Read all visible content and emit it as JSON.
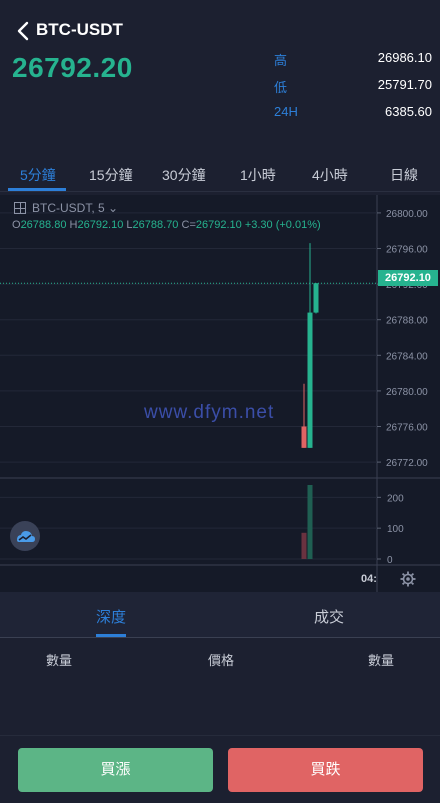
{
  "header": {
    "pair": "BTC-USDT",
    "last_price": "26792.20",
    "stats": [
      {
        "label": "高",
        "value": "26986.10"
      },
      {
        "label": "低",
        "value": "25791.70"
      },
      {
        "label": "24H",
        "value": "6385.60"
      }
    ]
  },
  "tabs": [
    {
      "label": "5分鐘",
      "active": true
    },
    {
      "label": "15分鐘"
    },
    {
      "label": "30分鐘"
    },
    {
      "label": "1小時"
    },
    {
      "label": "4小時"
    },
    {
      "label": "日線"
    }
  ],
  "chart": {
    "symbol_label": "BTC-USDT, 5",
    "ohlc": {
      "o_label": "O",
      "o": "26788.80",
      "h_label": "H",
      "h": "26792.10",
      "l_label": "L",
      "l": "26788.70",
      "c_label": "C=",
      "c": "26792.10",
      "change": "+3.30 (+0.01%)"
    },
    "current_price_tag": "26792.10",
    "watermark": "www.dfym.net",
    "time_label": "04:",
    "colors": {
      "up": "#26b38f",
      "down": "#e06464",
      "accent": "#2d7fd8"
    }
  },
  "chart_data": {
    "type": "candlestick",
    "y_ticks": [
      "26800.00",
      "26796.00",
      "26792.00",
      "26788.00",
      "26784.00",
      "26780.00",
      "26776.00",
      "26772.00"
    ],
    "ylim": [
      26771,
      26801
    ],
    "candles": [
      {
        "o": 26776.0,
        "h": 26780.8,
        "l": 26773.6,
        "c": 26773.6,
        "dir": "down"
      },
      {
        "o": 26773.6,
        "h": 26796.6,
        "l": 26773.6,
        "c": 26788.8,
        "dir": "up"
      },
      {
        "o": 26788.8,
        "h": 26792.1,
        "l": 26788.7,
        "c": 26792.1,
        "dir": "up"
      }
    ],
    "volume_ticks": [
      "200",
      "100",
      "0"
    ],
    "volume_ylim": [
      0,
      240
    ],
    "volumes": [
      {
        "v": 85,
        "dir": "down"
      },
      {
        "v": 240,
        "dir": "up"
      },
      {
        "v": 0,
        "dir": "up"
      }
    ]
  },
  "depth": {
    "tabs": [
      {
        "label": "深度",
        "active": true
      },
      {
        "label": "成交"
      }
    ],
    "columns": [
      "數量",
      "價格",
      "數量"
    ]
  },
  "footer": {
    "buy_label": "買漲",
    "sell_label": "買跌"
  }
}
